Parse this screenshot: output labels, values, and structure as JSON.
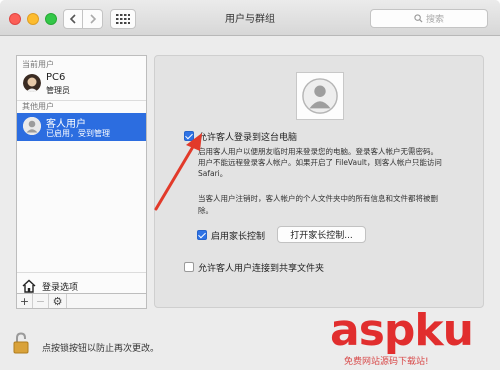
{
  "window": {
    "title": "用户与群组",
    "search_placeholder": "搜索"
  },
  "sidebar": {
    "current_users_label": "当前用户",
    "current_user": {
      "name": "PC6",
      "role": "管理员"
    },
    "other_users_label": "其他用户",
    "guest_user": {
      "name": "客人用户",
      "status": "已启用，受到管理"
    },
    "login_options_label": "登录选项",
    "toolbar": {
      "add": "+",
      "remove": "−",
      "gear": "⚙"
    }
  },
  "panel": {
    "allow_login_label": "允许客人登录到这台电脑",
    "allow_login_checked": true,
    "allow_login_desc": [
      "启用客人用户以便朋友临时用来登录您的电脑。登录客人帐户无需密码。",
      "用户不能远程登录客人帐户。如果开启了 FileVault，则客人帐户只能访问",
      "Safari。"
    ],
    "logout_note": [
      "当客人用户注销时，客人帐户的个人文件夹中的所有信息和文件都将被删",
      "除。"
    ],
    "parental_label": "启用家长控制",
    "parental_checked": true,
    "open_parental_button": "打开家长控制...",
    "shared_folders_label": "允许客人用户连接到共享文件夹",
    "shared_folders_checked": false
  },
  "footer": {
    "lock_text": "点按锁按钮以防止再次更改。"
  },
  "watermark": {
    "brand": "aspku",
    "tagline": "免费网站源码下载站!"
  },
  "colors": {
    "selection": "#2c6de0",
    "checkbox_checked": "#2f73e5",
    "arrow": "#e23a2a",
    "watermark": "#e12e2e"
  }
}
